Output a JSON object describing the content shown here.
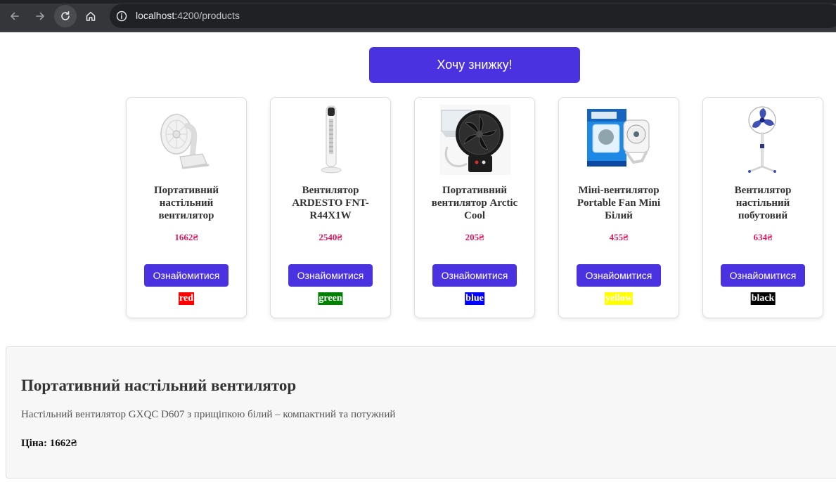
{
  "browser": {
    "url_host": "localhost",
    "url_rest": ":4200/products"
  },
  "discount_button": "Хочу знижку!",
  "products": [
    {
      "name": "Портативний настільний вентилятор",
      "price": "1662₴",
      "button": "Ознайомитися",
      "color": "red",
      "color_bg": "#ff0000",
      "color_fg": "#ffffff",
      "image": "clip-fan"
    },
    {
      "name": "Вентилятор ARDESTO FNT-R44X1W",
      "price": "2540₴",
      "button": "Ознайомитися",
      "color": "green",
      "color_bg": "#008000",
      "color_fg": "#ffffff",
      "image": "tower-fan"
    },
    {
      "name": "Портативний вентилятор Arctic Cool",
      "price": "205₴",
      "button": "Ознайомитися",
      "color": "blue",
      "color_bg": "#0000ff",
      "color_fg": "#ffffff",
      "image": "usb-fan"
    },
    {
      "name": "Міні-вентилятор Portable Fan Mini Білий",
      "price": "455₴",
      "button": "Ознайомитися",
      "color": "yellow",
      "color_bg": "#ffff00",
      "color_fg": "#ffffff",
      "image": "mini-fan-box"
    },
    {
      "name": "Вентилятор настільний побутовий",
      "price": "634₴",
      "button": "Ознайомитися",
      "color": "black",
      "color_bg": "#000000",
      "color_fg": "#ffffff",
      "image": "stand-fan"
    }
  ],
  "selected": {
    "title": "Портативний настільний вентилятор",
    "description": "Настільний вентилятор GXQC D607 з прищіпкою білий – компактний та потужний",
    "price_label": "Ціна: 1662₴"
  },
  "colors": {
    "accent": "#4b32e0",
    "price": "#d81b60"
  }
}
